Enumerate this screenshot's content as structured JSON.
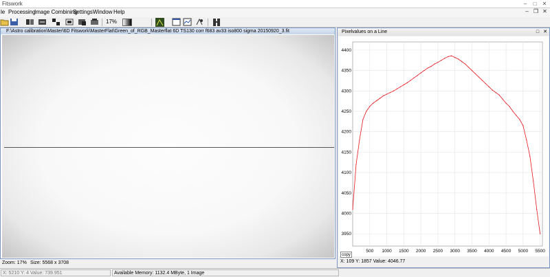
{
  "app": {
    "title": "Fitswork"
  },
  "menu": [
    "le",
    "Processing",
    "Image Combining",
    "Settings",
    "Window",
    "Help"
  ],
  "toolbar": {
    "zoom": "17%"
  },
  "image_window": {
    "title": "F:\\Astro calibration\\Master\\6D Fitswork\\MasterFlat\\Green_of_RGB_Masterflat 6D TS130 corr f683 av33 iso800 sigma 20150920_3.fit"
  },
  "status": {
    "zoom": "Zoom: 17%",
    "size": "Size: 5568 x 3708"
  },
  "bottom": {
    "coords": "X: 5210  Y: 4  Value: 739.951",
    "memory": "Available Memory: 1132.4 MByte, 1 Image"
  },
  "plot_window": {
    "title": "Pixelvalues on a Line",
    "copy": "copy",
    "readout": "X: 109   Y: 1857   Value: 4046.77"
  },
  "colors": {
    "line": "#e8141c",
    "frame": "#7a96c0"
  },
  "chart_data": {
    "type": "line",
    "title": "",
    "xlabel": "",
    "ylabel": "",
    "xlim": [
      0,
      5568
    ],
    "ylim": [
      3920,
      4420
    ],
    "xticks": [
      500,
      1000,
      1500,
      2000,
      2500,
      3000,
      3500,
      4000,
      4500,
      5000,
      5500
    ],
    "xtick_labels": [
      "500",
      "1000",
      "1500",
      "2000",
      "2500",
      "3000",
      "3500",
      "4000",
      "4500",
      "5000",
      "5500"
    ],
    "yticks": [
      3950,
      4000,
      4050,
      4100,
      4150,
      4200,
      4250,
      4300,
      4350,
      4400
    ],
    "ytick_labels": [
      "3950",
      "4000",
      "4050",
      "4100",
      "4150",
      "4200",
      "4250",
      "4300",
      "4350",
      "4400"
    ],
    "grid": true,
    "series": [
      {
        "x": [
          0,
          100,
          200,
          300,
          400,
          500,
          600,
          700,
          800,
          900,
          1000,
          1100,
          1200,
          1300,
          1400,
          1500,
          1600,
          1700,
          1800,
          1900,
          2000,
          2100,
          2200,
          2300,
          2400,
          2500,
          2600,
          2700,
          2800,
          2900,
          3000,
          3100,
          3200,
          3300,
          3400,
          3500,
          3600,
          3700,
          3800,
          3900,
          4000,
          4100,
          4200,
          4300,
          4400,
          4500,
          4600,
          4700,
          4800,
          4900,
          5000,
          5100,
          5200,
          5300,
          5400,
          5500
        ],
        "y": [
          4010,
          4120,
          4180,
          4230,
          4250,
          4262,
          4270,
          4276,
          4282,
          4288,
          4292,
          4296,
          4300,
          4305,
          4310,
          4315,
          4320,
          4326,
          4332,
          4338,
          4344,
          4350,
          4356,
          4360,
          4366,
          4370,
          4375,
          4380,
          4384,
          4386,
          4382,
          4378,
          4372,
          4366,
          4358,
          4350,
          4342,
          4334,
          4326,
          4318,
          4310,
          4302,
          4296,
          4290,
          4280,
          4270,
          4262,
          4250,
          4240,
          4230,
          4215,
          4180,
          4140,
          4080,
          4010,
          3950
        ]
      }
    ]
  }
}
